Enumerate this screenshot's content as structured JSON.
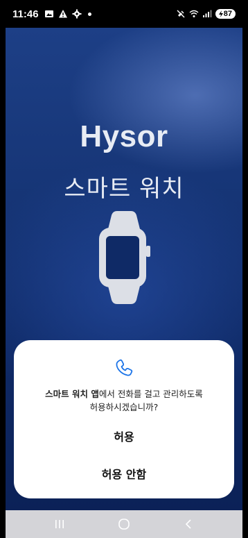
{
  "status_bar": {
    "time": "11:46",
    "battery": "87",
    "icons": [
      "image-icon",
      "alert-triangle-icon",
      "settings-icon",
      "notification-dot",
      "mute-icon",
      "wifi-icon",
      "signal-icon",
      "battery-charging-icon"
    ]
  },
  "hero": {
    "brand": "Hysor",
    "subtitle": "스마트 워치",
    "illustration": "smartwatch-icon"
  },
  "dialog": {
    "icon": "phone-icon",
    "message_app": "스마트 워치 앱",
    "message_rest_line1": "에서 전화를 걸고 관리하도록",
    "message_line2": "허용하시겠습니까?",
    "allow_label": "허용",
    "deny_label": "허용 안함"
  },
  "nav_bar": {
    "recent": "recent-apps-icon",
    "home": "home-icon",
    "back": "back-icon"
  },
  "colors": {
    "background_top": "#1d3f86",
    "background_bottom": "#0b2157",
    "dialog_bg": "#ffffff",
    "accent": "#1a73e8",
    "nav_bg": "#d4d4d8"
  }
}
